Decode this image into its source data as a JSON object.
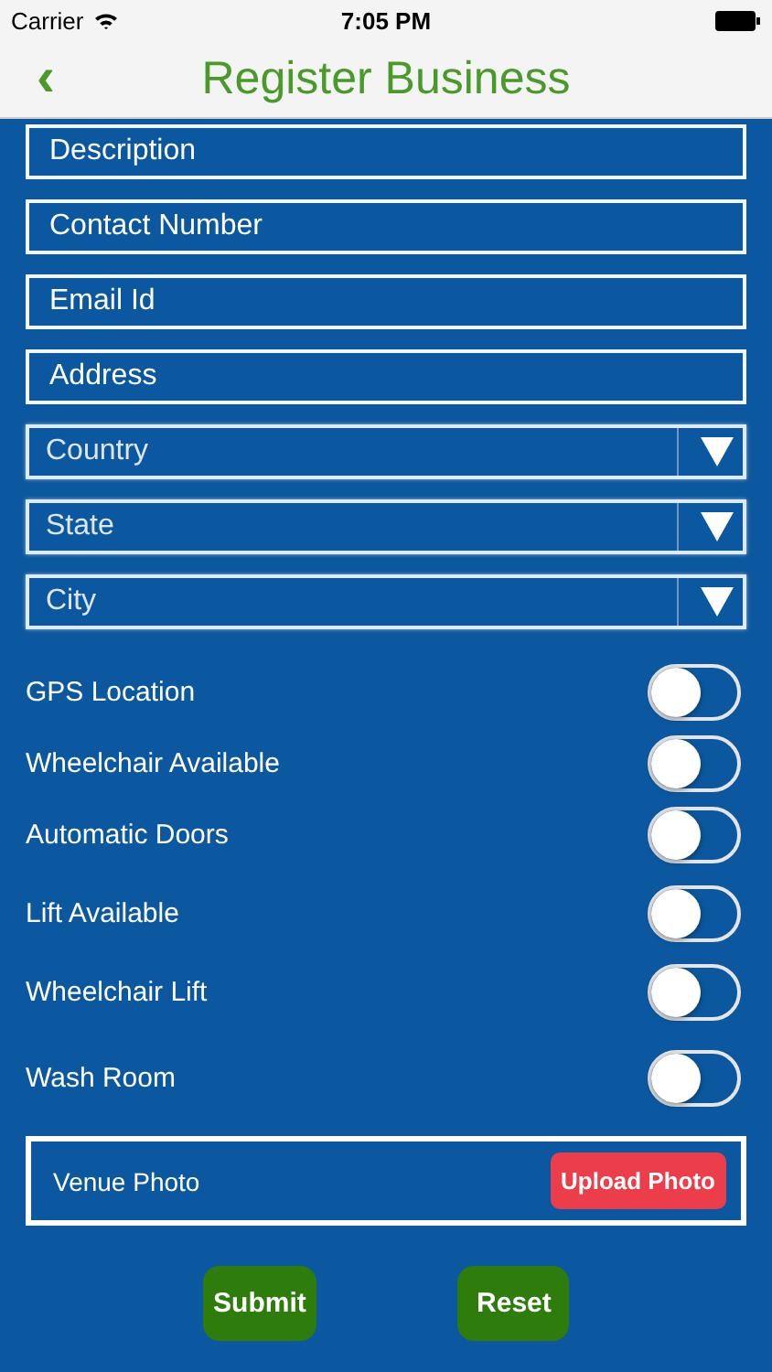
{
  "status_bar": {
    "carrier": "Carrier",
    "time": "7:05 PM"
  },
  "nav": {
    "back": "‹",
    "title": "Register Business"
  },
  "fields": [
    {
      "placeholder": "Description"
    },
    {
      "placeholder": "Contact Number"
    },
    {
      "placeholder": "Email Id"
    },
    {
      "placeholder": "Address"
    }
  ],
  "dropdowns": [
    {
      "label": "Country"
    },
    {
      "label": "State"
    },
    {
      "label": "City"
    }
  ],
  "toggles": [
    {
      "label": "GPS Location",
      "on": false
    },
    {
      "label": "Wheelchair Available",
      "on": false
    },
    {
      "label": "Automatic Doors",
      "on": false
    },
    {
      "label": "Lift Available",
      "on": false
    },
    {
      "label": "Wheelchair Lift",
      "on": false
    },
    {
      "label": "Wash Room",
      "on": false
    }
  ],
  "photo": {
    "label": "Venue Photo",
    "button": "Upload Photo"
  },
  "buttons": [
    "Submit",
    "Reset"
  ]
}
